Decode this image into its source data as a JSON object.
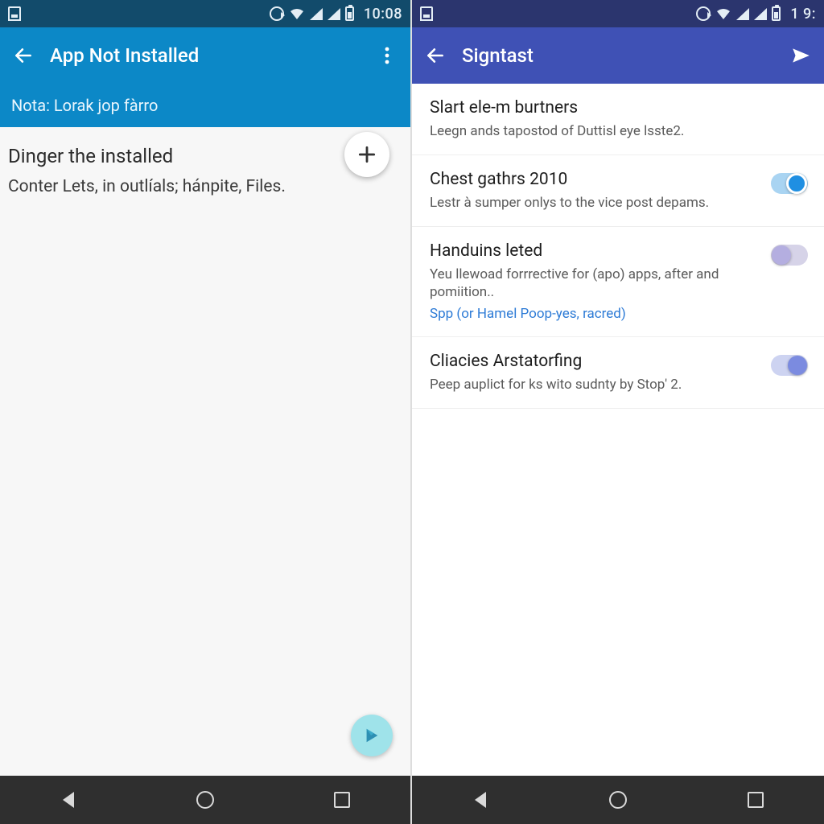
{
  "left": {
    "statusbar": {
      "time": "10:08"
    },
    "appbar": {
      "title": "App Not Installed"
    },
    "subtitle": "Nota: Lorak jop fàrro",
    "heading": "Dinger the installed",
    "body": "Conter Lets, in outlíals; hánpite, Files."
  },
  "right": {
    "statusbar": {
      "time": "1 9:"
    },
    "appbar": {
      "title": "Signtast"
    },
    "settings": [
      {
        "title": "Slart ele-m burtners",
        "sub": "Leegn ands tapostod of Duttisl eye lsste2.",
        "toggle": null,
        "link": null
      },
      {
        "title": "Chest gathrs 2010",
        "sub": "Lestr à sumper onlys to the vice post depams.",
        "toggle": "on-blue",
        "link": null
      },
      {
        "title": "Handuins leted",
        "sub": "Yeu llewoad forrrective for (apo) apps, after and pomiition..",
        "toggle": "off-grey",
        "link": "Spp (or Hamel Poop-yes, racred)"
      },
      {
        "title": "Cliacies Arstatorfing",
        "sub": "Peep auplict for ks wito sudnty by Stop' 2.",
        "toggle": "on-purple",
        "link": null
      }
    ]
  }
}
